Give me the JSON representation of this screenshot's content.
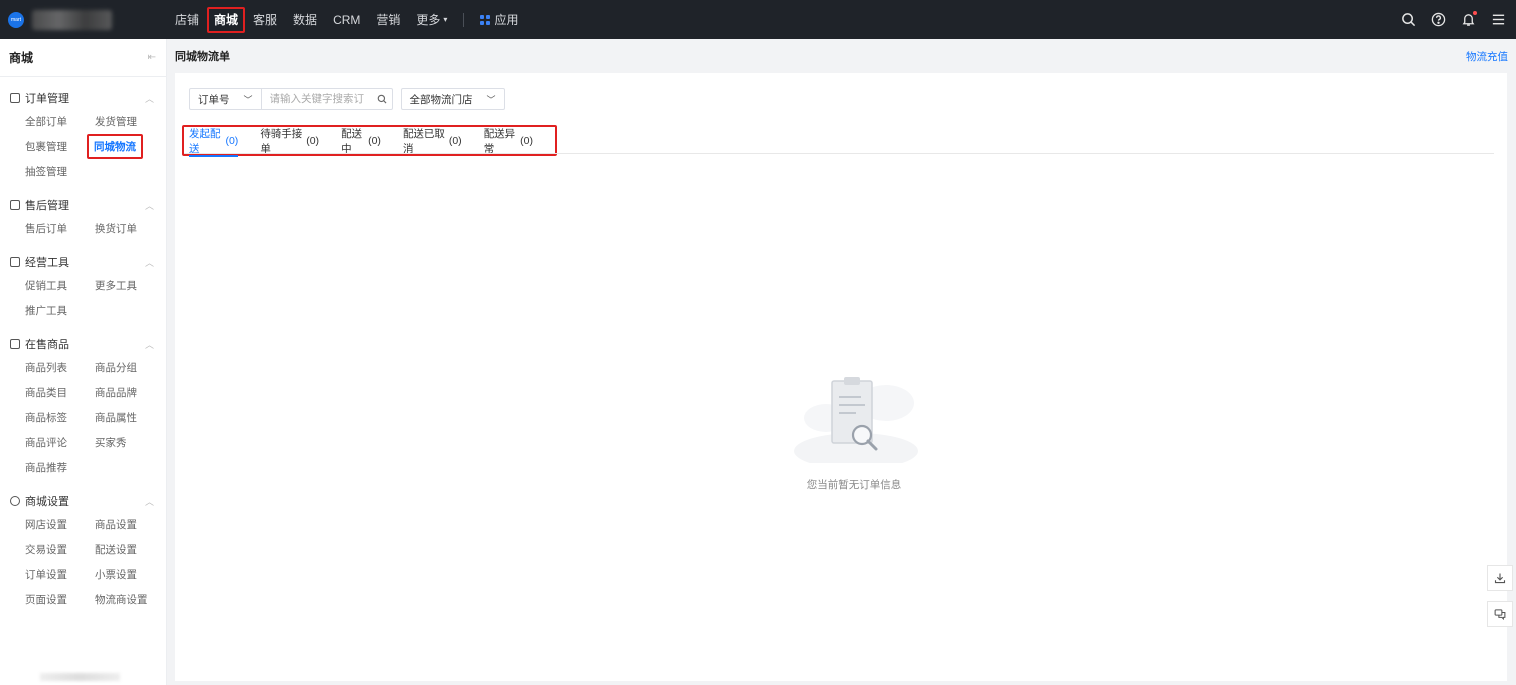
{
  "topbar": {
    "logo_text": "mart",
    "nav": [
      {
        "label": "店铺",
        "active": false
      },
      {
        "label": "商城",
        "active": true
      },
      {
        "label": "客服",
        "active": false
      },
      {
        "label": "数据",
        "active": false
      },
      {
        "label": "CRM",
        "active": false
      },
      {
        "label": "营销",
        "active": false
      },
      {
        "label": "更多",
        "active": false
      }
    ],
    "more_caret": "▾",
    "apps_label": "应用",
    "right_icons": [
      "search-icon",
      "help-icon",
      "bell-icon",
      "menu-icon"
    ]
  },
  "sidebar": {
    "title": "商城",
    "groups": [
      {
        "title": "订单管理",
        "links": [
          "全部订单",
          "发货管理",
          "包裹管理",
          "同城物流",
          "抽签管理"
        ]
      },
      {
        "title": "售后管理",
        "links": [
          "售后订单",
          "换货订单"
        ]
      },
      {
        "title": "经营工具",
        "links": [
          "促销工具",
          "更多工具",
          "推广工具"
        ]
      },
      {
        "title": "在售商品",
        "links": [
          "商品列表",
          "商品分组",
          "商品类目",
          "商品品牌",
          "商品标签",
          "商品属性",
          "商品评论",
          "买家秀",
          "商品推荐"
        ]
      },
      {
        "title": "商城设置",
        "links": [
          "网店设置",
          "商品设置",
          "交易设置",
          "配送设置",
          "订单设置",
          "小票设置",
          "页面设置",
          "物流商设置"
        ]
      }
    ],
    "active_link": "同城物流"
  },
  "main": {
    "page_title": "同城物流单",
    "recharge_link": "物流充值",
    "filter": {
      "field_select": "订单号",
      "search_placeholder": "请输入关键字搜索订单",
      "store_select": "全部物流门店"
    },
    "tabs": [
      {
        "label": "发起配送",
        "count": "(0)",
        "active": true
      },
      {
        "label": "待骑手接单",
        "count": "(0)",
        "active": false
      },
      {
        "label": "配送中",
        "count": "(0)",
        "active": false
      },
      {
        "label": "配送已取消",
        "count": "(0)",
        "active": false
      },
      {
        "label": "配送异常",
        "count": "(0)",
        "active": false
      }
    ],
    "empty_text": "您当前暂无订单信息"
  },
  "colors": {
    "topbar_bg": "#1f2329",
    "accent": "#1677ff",
    "highlight_red": "#e02020"
  }
}
